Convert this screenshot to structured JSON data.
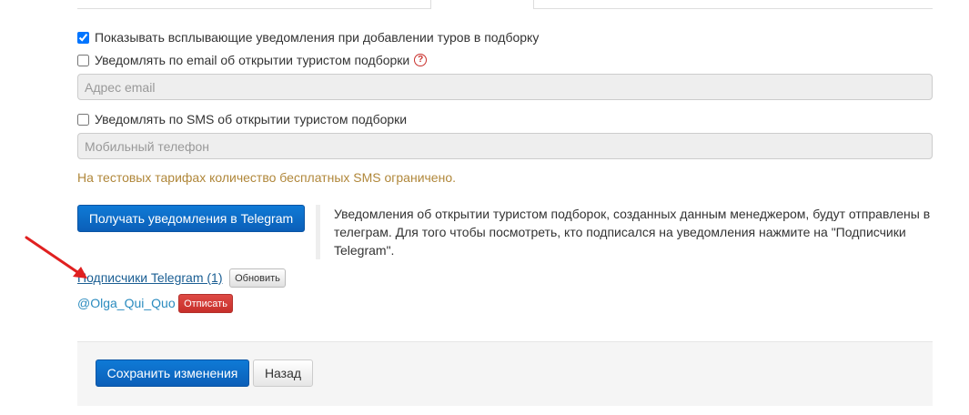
{
  "colors": {
    "primary": "#0b5fb8",
    "danger": "#c72f2a",
    "warning_text": "#b0873a",
    "link": "#1a5e93",
    "annotation_arrow": "#e02020"
  },
  "notifications": {
    "popup": {
      "label": "Показывать всплывающие уведомления при добавлении туров в подборку",
      "checked": true
    },
    "email": {
      "label": "Уведомлять по email об открытии туристом подборки",
      "checked": false,
      "help_icon": "question-circle-icon"
    },
    "email_input": {
      "placeholder": "Адрес email",
      "value": ""
    },
    "sms": {
      "label": "Уведомлять по SMS об открытии туристом подборки",
      "checked": false
    },
    "sms_input": {
      "placeholder": "Мобильный телефон",
      "value": ""
    },
    "sms_warning": "На тестовых тарифах количество бесплатных SMS ограничено."
  },
  "telegram": {
    "button_label": "Получать уведомления в Telegram",
    "info_text": "Уведомления об открытии туристом подборок, созданных данным менеджером, будут отправлены в телеграм. Для того чтобы посмотреть, кто подписался на уведомления нажмите на \"Подписчики Telegram\".",
    "subscribers_link": "Подписчики Telegram (1)",
    "refresh_label": "Обновить",
    "subscribers": [
      {
        "username": "@Olga_Qui_Quo",
        "unsubscribe_label": "Отписать"
      }
    ]
  },
  "footer": {
    "save_label": "Сохранить изменения",
    "back_label": "Назад"
  }
}
